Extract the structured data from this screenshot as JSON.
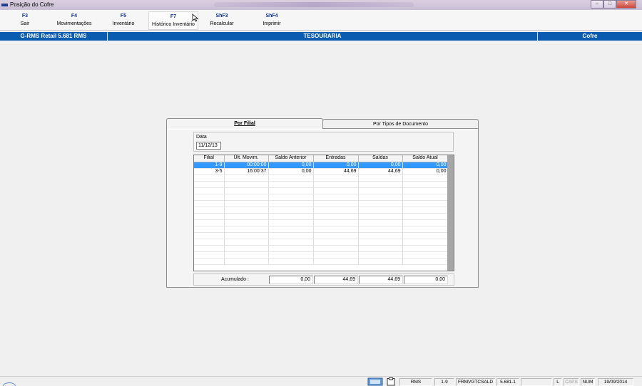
{
  "window": {
    "title": "Posição do Cofre",
    "buttons": {
      "minimize": "–",
      "maximize": "□",
      "close": "✕"
    }
  },
  "toolbar": {
    "items": [
      {
        "key": "F3",
        "label": "Sair"
      },
      {
        "key": "F4",
        "label": "Movimentações"
      },
      {
        "key": "F5",
        "label": "Inventário"
      },
      {
        "key": "F7",
        "label": "Histórico Inventário"
      },
      {
        "key": "ShF3",
        "label": "Recalcular"
      },
      {
        "key": "ShF4",
        "label": "Imprimir"
      }
    ]
  },
  "header": {
    "product": "G-RMS Retail 5.681 RMS",
    "module": "TESOURARIA",
    "screen": "Cofre"
  },
  "tabs": {
    "por_filial": "Por Filial",
    "por_tipos": "Por Tipos de Documento"
  },
  "date": {
    "label": "Data",
    "value": "11/12/13"
  },
  "grid": {
    "columns": [
      "Filial",
      "Últ. Movim.",
      "Saldo Anterior",
      "Entradas",
      "Saídas",
      "Saldo Atual"
    ],
    "rows": [
      {
        "filial": "1-9",
        "ult_movim": "00:00:00",
        "saldo_anterior": "0,00",
        "entradas": "0,00",
        "saidas": "0,00",
        "saldo_atual": "0,00"
      },
      {
        "filial": "3-5",
        "ult_movim": "16:00:37",
        "saldo_anterior": "0,00",
        "entradas": "44,69",
        "saidas": "44,69",
        "saldo_atual": "0,00"
      }
    ]
  },
  "totals": {
    "label": "Acumulado :",
    "saldo_anterior": "0,00",
    "entradas": "44,69",
    "saidas": "44,69",
    "saldo_atual": "0,00"
  },
  "statusbar": {
    "system": "RMS",
    "filial": "1-9",
    "program": "FRMVGTCSALD",
    "version": "5.681.1",
    "indicators": [
      "L",
      "CAPS",
      "NUM"
    ],
    "date": "19/09/2014"
  },
  "colors": {
    "header_blue": "#0a5cb0",
    "selection_blue": "#3399ff",
    "toolbar_key": "#0b2f8a"
  }
}
